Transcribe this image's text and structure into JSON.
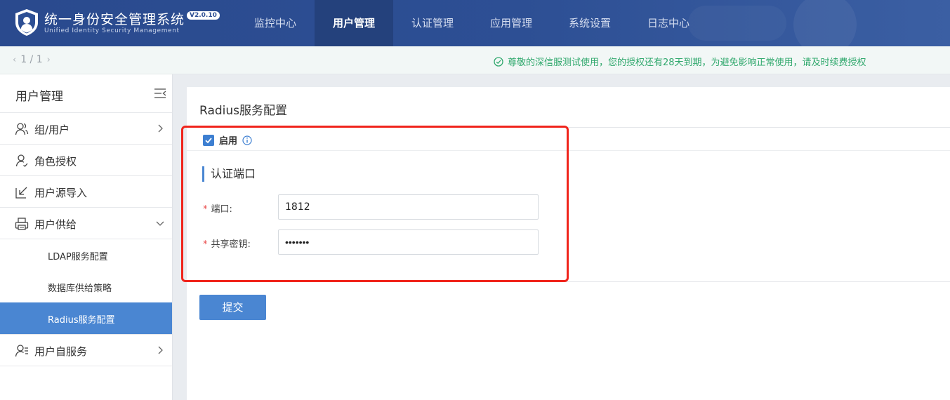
{
  "header": {
    "title": "统一身份安全管理系统",
    "subtitle": "Unified Identity Security Management",
    "version": "V2.0.10",
    "nav": [
      {
        "label": "监控中心"
      },
      {
        "label": "用户管理"
      },
      {
        "label": "认证管理"
      },
      {
        "label": "应用管理"
      },
      {
        "label": "系统设置"
      },
      {
        "label": "日志中心"
      }
    ],
    "active_nav": "用户管理"
  },
  "subbar": {
    "page_indicator": "1 / 1",
    "notice": "尊敬的深信服测试使用，您的授权还有28天到期，为避免影响正常使用，请及时续费授权"
  },
  "sidebar": {
    "title": "用户管理",
    "items": [
      {
        "label": "组/用户",
        "icon": "users-icon",
        "chevron": "right"
      },
      {
        "label": "角色授权",
        "icon": "role-icon"
      },
      {
        "label": "用户源导入",
        "icon": "import-icon"
      },
      {
        "label": "用户供给",
        "icon": "printer-icon",
        "chevron": "down"
      },
      {
        "label": "用户自服务",
        "icon": "self-service-icon",
        "chevron": "right"
      }
    ],
    "subitems": [
      {
        "label": "LDAP服务配置"
      },
      {
        "label": "数据库供给策略"
      },
      {
        "label": "Radius服务配置"
      }
    ],
    "active_subitem": "Radius服务配置"
  },
  "main": {
    "title": "Radius服务配置",
    "enable_label": "启用",
    "enabled": true,
    "section_title": "认证端口",
    "port_label": "端口:",
    "port_value": "1812",
    "secret_label": "共享密钥:",
    "secret_value": "1234567",
    "submit_label": "提交"
  },
  "colors": {
    "header_bg": "#2d4f94",
    "accent": "#4a86d2",
    "notice_text": "#2fa86c",
    "highlight_border": "#f0241c",
    "required_mark": "#e94a4a"
  }
}
